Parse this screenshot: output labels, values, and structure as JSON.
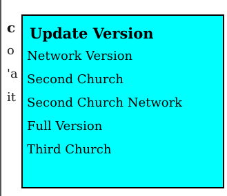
{
  "background_page": {
    "fragments": [
      "c",
      "o",
      "'a",
      "it"
    ]
  },
  "popup": {
    "title": "Update Version",
    "items": [
      {
        "label": "Network Version"
      },
      {
        "label": "Second Church"
      },
      {
        "label": "Second Church Network"
      },
      {
        "label": "Full Version"
      },
      {
        "label": "Third Church"
      }
    ]
  },
  "colors": {
    "popup_background": "#00ffff",
    "popup_border": "#000000",
    "text": "#000000",
    "page_background": "#ffffff"
  }
}
